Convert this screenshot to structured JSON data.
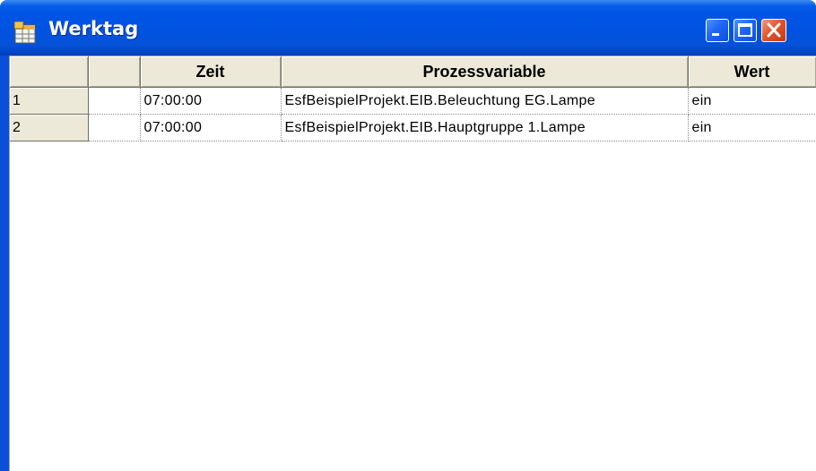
{
  "window": {
    "title": "Werktag",
    "icon": "app-table-icon",
    "controls": {
      "minimize_icon": "minimize-icon",
      "maximize_icon": "maximize-icon",
      "close_icon": "close-icon"
    }
  },
  "grid": {
    "columns": [
      "",
      "",
      "Zeit",
      "Prozessvariable",
      "Wert"
    ],
    "rows": [
      {
        "index": "1",
        "flag": "",
        "zeit": "07:00:00",
        "variable": "EsfBeispielProjekt.EIB.Beleuchtung EG.Lampe",
        "wert": "ein"
      },
      {
        "index": "2",
        "flag": "",
        "zeit": "07:00:00",
        "variable": "EsfBeispielProjekt.EIB.Hauptgruppe 1.Lampe",
        "wert": "ein"
      }
    ]
  },
  "colors": {
    "titlebar": "#0055e5",
    "close_button": "#e3552c",
    "header_face": "#ece9d8"
  }
}
